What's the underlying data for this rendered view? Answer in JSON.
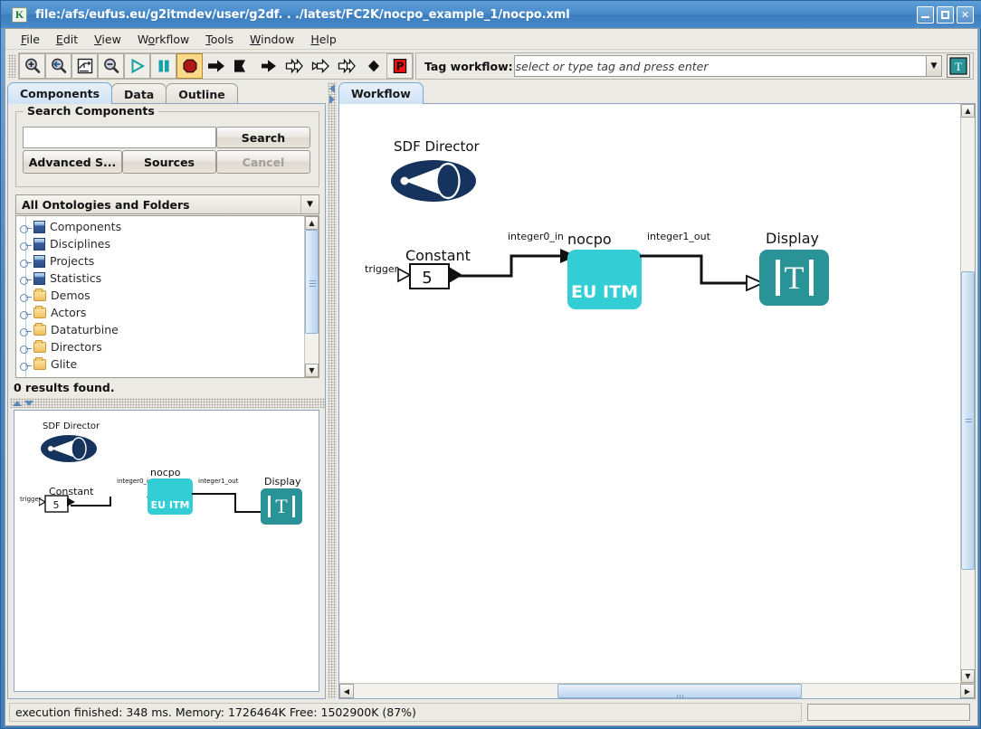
{
  "window": {
    "title": "file:/afs/eufus.eu/g2itmdev/user/g2df. . ./latest/FC2K/nocpo_example_1/nocpo.xml",
    "app_icon_letter": "K",
    "minimize_label": "_",
    "maximize_label": "□",
    "close_label": "✕"
  },
  "menubar": {
    "items": [
      {
        "label": "File",
        "mnemonic": "F"
      },
      {
        "label": "Edit",
        "mnemonic": "E"
      },
      {
        "label": "View",
        "mnemonic": "V"
      },
      {
        "label": "Workflow",
        "mnemonic": "o"
      },
      {
        "label": "Tools",
        "mnemonic": "T"
      },
      {
        "label": "Window",
        "mnemonic": "W"
      },
      {
        "label": "Help",
        "mnemonic": "H"
      }
    ]
  },
  "toolbar": {
    "buttons": [
      {
        "name": "zoom-in-icon",
        "tip": "Zoom in"
      },
      {
        "name": "zoom-reset-icon",
        "tip": "Zoom reset"
      },
      {
        "name": "zoom-fit-icon",
        "tip": "Zoom fit"
      },
      {
        "name": "zoom-out-icon",
        "tip": "Zoom out"
      },
      {
        "name": "run-icon",
        "tip": "Run"
      },
      {
        "name": "pause-icon",
        "tip": "Pause"
      },
      {
        "name": "stop-icon",
        "tip": "Stop"
      },
      {
        "name": "step-icon",
        "tip": "Step"
      },
      {
        "name": "run-to-icon",
        "tip": "Run to"
      },
      {
        "name": "step-into-icon",
        "tip": "Step into"
      },
      {
        "name": "fast-forward-icon",
        "tip": "Fast forward"
      },
      {
        "name": "skip-icon",
        "tip": "Skip"
      },
      {
        "name": "forward-outline-icon",
        "tip": "Forward"
      },
      {
        "name": "diamond-icon",
        "tip": "Breakpoint"
      },
      {
        "name": "pause-p-icon",
        "tip": "P"
      }
    ],
    "tag_label": "Tag workflow:",
    "tag_placeholder": "select or type tag and press enter",
    "tag_button_letter": "T",
    "dropdown_arrow": "▼"
  },
  "left_panel": {
    "tabs": [
      {
        "label": "Components",
        "active": true
      },
      {
        "label": "Data",
        "active": false
      },
      {
        "label": "Outline",
        "active": false
      }
    ],
    "search_group_title": "Search Components",
    "search_input_value": "",
    "search_button": "Search",
    "advanced_button": "Advanced S...",
    "sources_button": "Sources",
    "cancel_button": "Cancel",
    "ontology_selector": "All Ontologies and Folders",
    "tree_items": [
      {
        "label": "Components",
        "icon": "database-icon"
      },
      {
        "label": "Disciplines",
        "icon": "database-icon"
      },
      {
        "label": "Projects",
        "icon": "database-icon"
      },
      {
        "label": "Statistics",
        "icon": "database-icon"
      },
      {
        "label": "Demos",
        "icon": "folder-icon"
      },
      {
        "label": "Actors",
        "icon": "folder-icon"
      },
      {
        "label": "Dataturbine",
        "icon": "folder-icon"
      },
      {
        "label": "Directors",
        "icon": "folder-icon"
      },
      {
        "label": "Glite",
        "icon": "folder-icon"
      }
    ],
    "results_text": "0 results found."
  },
  "workflow": {
    "tabs": [
      {
        "label": "Workflow",
        "active": true
      }
    ],
    "graph": {
      "director": {
        "label": "SDF Director"
      },
      "nodes": [
        {
          "id": "constant",
          "label": "Constant",
          "value": "5",
          "port_in": "trigger"
        },
        {
          "id": "nocpo",
          "label": "nocpo",
          "value": "EU ITM"
        },
        {
          "id": "display",
          "label": "Display",
          "value": "T"
        }
      ],
      "links": [
        {
          "from": "constant",
          "to": "nocpo",
          "label": "integer0_in"
        },
        {
          "from": "nocpo",
          "to": "display",
          "label": "integer1_out"
        }
      ]
    }
  },
  "statusbar": {
    "message": "execution finished: 348 ms. Memory: 1726464K Free: 1502900K (87%)",
    "progress_value": ""
  },
  "colors": {
    "title_blue": "#4a8ccb",
    "nocpo_cyan": "#33cdd6",
    "display_teal": "#2a9398",
    "director_navy": "#16335e",
    "stop_red": "#b01818",
    "accent_panel": "#eceae4"
  }
}
